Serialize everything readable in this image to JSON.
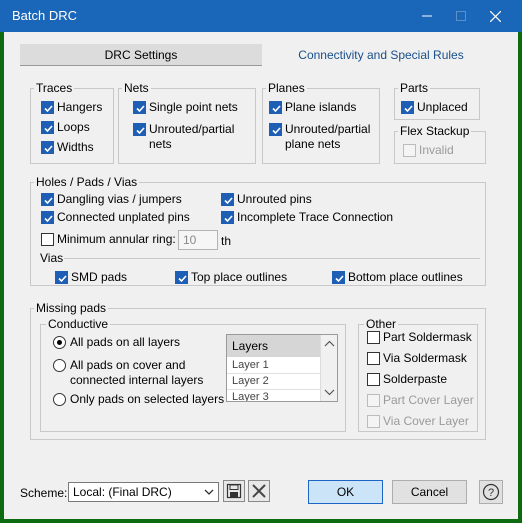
{
  "window": {
    "title": "Batch DRC"
  },
  "tabs": [
    {
      "label": "DRC Settings",
      "active": true
    },
    {
      "label": "Connectivity and Special Rules",
      "active": false
    }
  ],
  "traces": {
    "label": "Traces",
    "items": [
      {
        "label": "Hangers",
        "checked": true
      },
      {
        "label": "Loops",
        "checked": true
      },
      {
        "label": "Widths",
        "checked": true
      }
    ]
  },
  "nets": {
    "label": "Nets",
    "items": [
      {
        "label": "Single point nets",
        "checked": true
      },
      {
        "label_line1": "Unrouted/partial",
        "label_line2": "nets",
        "checked": true
      }
    ]
  },
  "planes": {
    "label": "Planes",
    "items": [
      {
        "label": "Plane islands",
        "checked": true
      },
      {
        "label_line1": "Unrouted/partial",
        "label_line2": "plane nets",
        "checked": true
      }
    ]
  },
  "parts": {
    "label": "Parts",
    "items": [
      {
        "label": "Unplaced",
        "checked": true
      }
    ]
  },
  "flex_stackup": {
    "label": "Flex Stackup",
    "items": [
      {
        "label": "Invalid",
        "checked": false,
        "disabled": true
      }
    ]
  },
  "holes": {
    "label": "Holes / Pads / Vias",
    "items": [
      {
        "label": "Dangling vias / jumpers",
        "checked": true
      },
      {
        "label": "Unrouted pins",
        "checked": true
      },
      {
        "label": "Connected unplated pins",
        "checked": true
      },
      {
        "label": "Incomplete Trace Connection",
        "checked": true
      },
      {
        "label": "Minimum annular ring:",
        "checked": false
      }
    ],
    "annular_value": "10",
    "annular_unit": "th",
    "vias_label": "Vias",
    "vias_items": [
      {
        "label": "SMD pads",
        "checked": true
      },
      {
        "label": "Top place outlines",
        "checked": true
      },
      {
        "label": "Bottom place outlines",
        "checked": true
      }
    ]
  },
  "missing_pads": {
    "label": "Missing pads",
    "conductive": {
      "label": "Conductive",
      "options": [
        {
          "label": "All pads on all layers",
          "selected": true
        },
        {
          "label_line1": "All pads on cover and",
          "label_line2": "connected internal layers",
          "selected": false
        },
        {
          "label": "Only pads on selected layers",
          "selected": false
        }
      ],
      "layers_header": "Layers",
      "layers": [
        "Layer 1",
        "Layer 2",
        "Layer 3"
      ]
    },
    "other": {
      "label": "Other",
      "items": [
        {
          "label": "Part Soldermask",
          "checked": false,
          "disabled": false
        },
        {
          "label": "Via Soldermask",
          "checked": false,
          "disabled": false
        },
        {
          "label": "Solderpaste",
          "checked": false,
          "disabled": false
        },
        {
          "label": "Part Cover Layer",
          "checked": false,
          "disabled": true
        },
        {
          "label": "Via Cover Layer",
          "checked": false,
          "disabled": true
        }
      ]
    }
  },
  "footer": {
    "scheme_label": "Scheme:",
    "scheme_value": "Local: (Final DRC)",
    "ok": "OK",
    "cancel": "Cancel",
    "help": "?"
  },
  "colors": {
    "titlebar": "#1a66b8",
    "check": "#1e5fb5",
    "ok_button": "#cce4f7"
  }
}
